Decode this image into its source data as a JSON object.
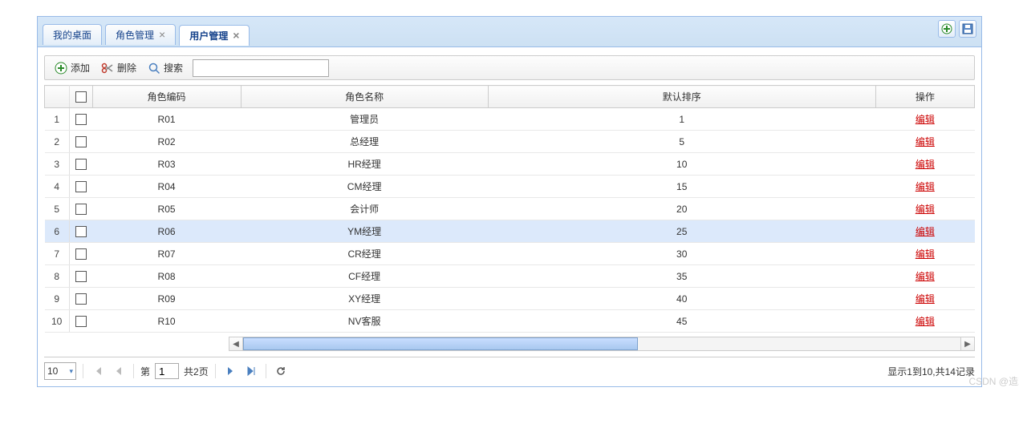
{
  "tabs": [
    {
      "label": "我的桌面",
      "closable": false,
      "active": false
    },
    {
      "label": "角色管理",
      "closable": true,
      "active": false
    },
    {
      "label": "用户管理",
      "closable": true,
      "active": true
    }
  ],
  "toolbar": {
    "add_label": "添加",
    "delete_label": "删除",
    "search_label": "搜索",
    "search_value": ""
  },
  "columns": {
    "code": "角色编码",
    "name": "角色名称",
    "sort": "默认排序",
    "op": "操作"
  },
  "rows": [
    {
      "num": "1",
      "code": "R01",
      "name": "管理员",
      "sort": "1",
      "op": "编辑",
      "selected": false
    },
    {
      "num": "2",
      "code": "R02",
      "name": "总经理",
      "sort": "5",
      "op": "编辑",
      "selected": false
    },
    {
      "num": "3",
      "code": "R03",
      "name": "HR经理",
      "sort": "10",
      "op": "编辑",
      "selected": false
    },
    {
      "num": "4",
      "code": "R04",
      "name": "CM经理",
      "sort": "15",
      "op": "编辑",
      "selected": false
    },
    {
      "num": "5",
      "code": "R05",
      "name": "会计师",
      "sort": "20",
      "op": "编辑",
      "selected": false
    },
    {
      "num": "6",
      "code": "R06",
      "name": "YM经理",
      "sort": "25",
      "op": "编辑",
      "selected": true
    },
    {
      "num": "7",
      "code": "R07",
      "name": "CR经理",
      "sort": "30",
      "op": "编辑",
      "selected": false
    },
    {
      "num": "8",
      "code": "R08",
      "name": "CF经理",
      "sort": "35",
      "op": "编辑",
      "selected": false
    },
    {
      "num": "9",
      "code": "R09",
      "name": "XY经理",
      "sort": "40",
      "op": "编辑",
      "selected": false
    },
    {
      "num": "10",
      "code": "R10",
      "name": "NV客服",
      "sort": "45",
      "op": "编辑",
      "selected": false
    }
  ],
  "pager": {
    "page_size": "10",
    "page_label_prefix": "第",
    "current_page": "1",
    "total_pages_label": "共2页",
    "info": "显示1到10,共14记录"
  },
  "watermark": "CSDN @造次阿"
}
